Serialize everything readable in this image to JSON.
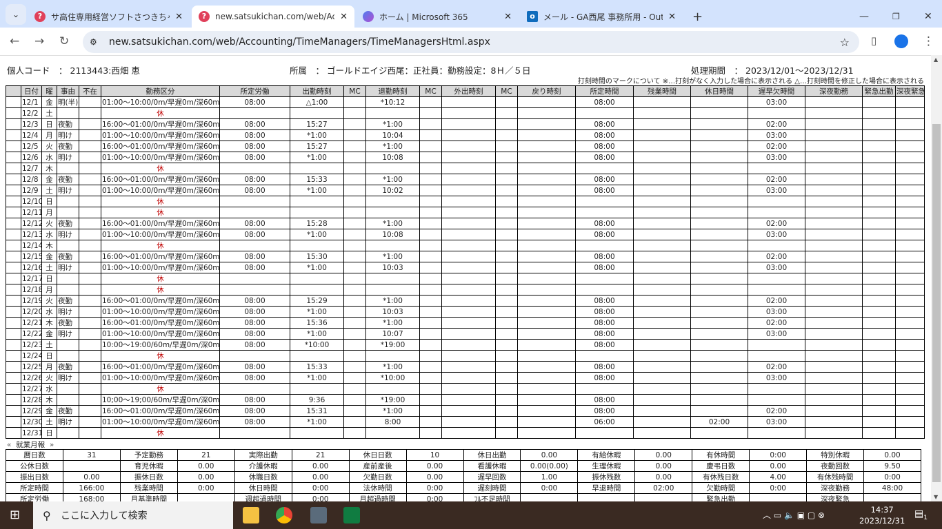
{
  "browser": {
    "tabs": [
      {
        "title": "サ高住専用経営ソフトさつきちゃん",
        "icon": "question-icon"
      },
      {
        "title": "new.satsukichan.com/web/Accou",
        "icon": "question-icon",
        "active": true
      },
      {
        "title": "ホーム | Microsoft 365",
        "icon": "m365-icon"
      },
      {
        "title": "メール - GA西尾 事務所用 - Outlo",
        "icon": "outlook-icon"
      }
    ],
    "url": "new.satsukichan.com/web/Accounting/TimeManagers/TimeManagersHtml.aspx"
  },
  "header": {
    "code_label": "個人コード　：",
    "code_value": "2113443:西畑 恵",
    "dept_label": "所属　：",
    "dept_value": "ゴールドエイジ西尾：正社員：勤務設定：8Ｈ／５日",
    "period_label": "処理期間　：",
    "period_value": "2023/12/01〜2023/12/31",
    "legend": "打刻時間のマークについて ※…打刻がなく入力した場合に表示される △…打刻時間を修正した場合に表示される"
  },
  "table": {
    "columns": [
      "",
      "日付",
      "曜",
      "事由",
      "不在",
      "勤務区分",
      "所定労働",
      "出勤時刻",
      "MC",
      "退勤時刻",
      "MC",
      "外出時刻",
      "MC",
      "戻り時刻",
      "所定時間",
      "残業時間",
      "休日時間",
      "遅早欠時間",
      "深夜勤務",
      "緊急出勤",
      "深夜緊急"
    ],
    "rows": [
      [
        "12/1",
        "金",
        "明(半)",
        "01:00〜10:00/0m/早遅0m/深60m",
        "08:00",
        "△1:00",
        "*10:12",
        "08:00",
        "",
        "03:00"
      ],
      [
        "12/2",
        "土",
        "",
        "休"
      ],
      [
        "12/3",
        "日",
        "夜勤",
        "16:00〜01:00/0m/早遅0m/深60m",
        "08:00",
        "15:27",
        "*1:00",
        "08:00",
        "",
        "02:00"
      ],
      [
        "12/4",
        "月",
        "明け",
        "01:00〜10:00/0m/早遅0m/深60m",
        "08:00",
        "*1:00",
        "10:04",
        "08:00",
        "",
        "03:00"
      ],
      [
        "12/5",
        "火",
        "夜勤",
        "16:00〜01:00/0m/早遅0m/深60m",
        "08:00",
        "15:27",
        "*1:00",
        "08:00",
        "",
        "02:00"
      ],
      [
        "12/6",
        "水",
        "明け",
        "01:00〜10:00/0m/早遅0m/深60m",
        "08:00",
        "*1:00",
        "10:08",
        "08:00",
        "",
        "03:00"
      ],
      [
        "12/7",
        "木",
        "",
        "休"
      ],
      [
        "12/8",
        "金",
        "夜勤",
        "16:00〜01:00/0m/早遅0m/深60m",
        "08:00",
        "15:33",
        "*1:00",
        "08:00",
        "",
        "02:00"
      ],
      [
        "12/9",
        "土",
        "明け",
        "01:00〜10:00/0m/早遅0m/深60m",
        "08:00",
        "*1:00",
        "10:02",
        "08:00",
        "",
        "03:00"
      ],
      [
        "12/10",
        "日",
        "",
        "休"
      ],
      [
        "12/11",
        "月",
        "",
        "休"
      ],
      [
        "12/12",
        "火",
        "夜勤",
        "16:00〜01:00/0m/早遅0m/深60m",
        "08:00",
        "15:28",
        "*1:00",
        "08:00",
        "",
        "02:00"
      ],
      [
        "12/13",
        "水",
        "明け",
        "01:00〜10:00/0m/早遅0m/深60m",
        "08:00",
        "*1:00",
        "10:08",
        "08:00",
        "",
        "03:00"
      ],
      [
        "12/14",
        "木",
        "",
        "休"
      ],
      [
        "12/15",
        "金",
        "夜勤",
        "16:00〜01:00/0m/早遅0m/深60m",
        "08:00",
        "15:30",
        "*1:00",
        "08:00",
        "",
        "02:00"
      ],
      [
        "12/16",
        "土",
        "明け",
        "01:00〜10:00/0m/早遅0m/深60m",
        "08:00",
        "*1:00",
        "10:03",
        "08:00",
        "",
        "03:00"
      ],
      [
        "12/17",
        "日",
        "",
        "休"
      ],
      [
        "12/18",
        "月",
        "",
        "休"
      ],
      [
        "12/19",
        "火",
        "夜勤",
        "16:00〜01:00/0m/早遅0m/深60m",
        "08:00",
        "15:29",
        "*1:00",
        "08:00",
        "",
        "02:00"
      ],
      [
        "12/20",
        "水",
        "明け",
        "01:00〜10:00/0m/早遅0m/深60m",
        "08:00",
        "*1:00",
        "10:03",
        "08:00",
        "",
        "03:00"
      ],
      [
        "12/21",
        "木",
        "夜勤",
        "16:00〜01:00/0m/早遅0m/深60m",
        "08:00",
        "15:36",
        "*1:00",
        "08:00",
        "",
        "02:00"
      ],
      [
        "12/22",
        "金",
        "明け",
        "01:00〜10:00/0m/早遅0m/深60m",
        "08:00",
        "*1:00",
        "10:07",
        "08:00",
        "",
        "03:00"
      ],
      [
        "12/23",
        "土",
        "",
        "10:00〜19:00/60m/早遅0m/深0m",
        "08:00",
        "*10:00",
        "*19:00",
        "08:00",
        "",
        ""
      ],
      [
        "12/24",
        "日",
        "",
        "休"
      ],
      [
        "12/25",
        "月",
        "夜勤",
        "16:00〜01:00/0m/早遅0m/深60m",
        "08:00",
        "15:33",
        "*1:00",
        "08:00",
        "",
        "02:00"
      ],
      [
        "12/26",
        "火",
        "明け",
        "01:00〜10:00/0m/早遅0m/深60m",
        "08:00",
        "*1:00",
        "*10:00",
        "08:00",
        "",
        "03:00"
      ],
      [
        "12/27",
        "水",
        "",
        "休"
      ],
      [
        "12/28",
        "木",
        "",
        "10;00〜19;00/60m/早遅0m/深0m",
        "08:00",
        "9:36",
        "*19:00",
        "08:00",
        "",
        ""
      ],
      [
        "12/29",
        "金",
        "夜勤",
        "16:00〜01:00/0m/早遅0m/深60m",
        "08:00",
        "15:31",
        "*1:00",
        "08:00",
        "",
        "02:00"
      ],
      [
        "12/30",
        "土",
        "明け",
        "01:00〜10:00/0m/早遅0m/深60m",
        "08:00",
        "*1:00",
        "8:00",
        "06:00",
        "02:00",
        "03:00"
      ],
      [
        "12/31",
        "日",
        "",
        "休"
      ]
    ]
  },
  "monthly": {
    "prev": "«",
    "title": "就業月報",
    "next": "»"
  },
  "summary": [
    [
      "暦日数",
      "31",
      "予定勤務",
      "21",
      "実際出勤",
      "21",
      "休日日数",
      "10",
      "休日出勤",
      "0.00",
      "有給休暇",
      "0.00",
      "有休時間",
      "0:00",
      "特別休暇",
      "0.00"
    ],
    [
      "公休日数",
      "",
      "育児休暇",
      "0.00",
      "介護休暇",
      "0.00",
      "産前産後",
      "0.00",
      "看護休暇",
      "0.00(0.00)",
      "生理休暇",
      "0.00",
      "慶弔日数",
      "0.00",
      "夜勤回数",
      "9.50"
    ],
    [
      "振出日数",
      "0.00",
      "振休日数",
      "0.00",
      "休職日数",
      "0.00",
      "欠勤日数",
      "0.00",
      "遅早回数",
      "1.00",
      "振休残数",
      "0.00",
      "有休残日数",
      "4.00",
      "有休残時間",
      "0:00"
    ],
    [
      "所定時間",
      "166:00",
      "残業時間",
      "0:00",
      "休日時間",
      "0:00",
      "法休時間",
      "0:00",
      "遅刻時間",
      "0:00",
      "早退時間",
      "02:00",
      "欠勤時間",
      "0:00",
      "深夜勤務",
      "48:00"
    ],
    [
      "所定労働",
      "168:00",
      "月基準時間",
      "",
      "週超過時間",
      "0:00",
      "月超過時間",
      "0:00",
      "ﾌﾙ不足時間",
      "",
      "",
      "",
      "緊急出勤",
      "",
      "深夜緊急",
      ""
    ]
  ],
  "taskbar": {
    "search_placeholder": "ここに入力して検索",
    "time": "14:37",
    "date": "2023/12/31",
    "notifications": "1"
  }
}
